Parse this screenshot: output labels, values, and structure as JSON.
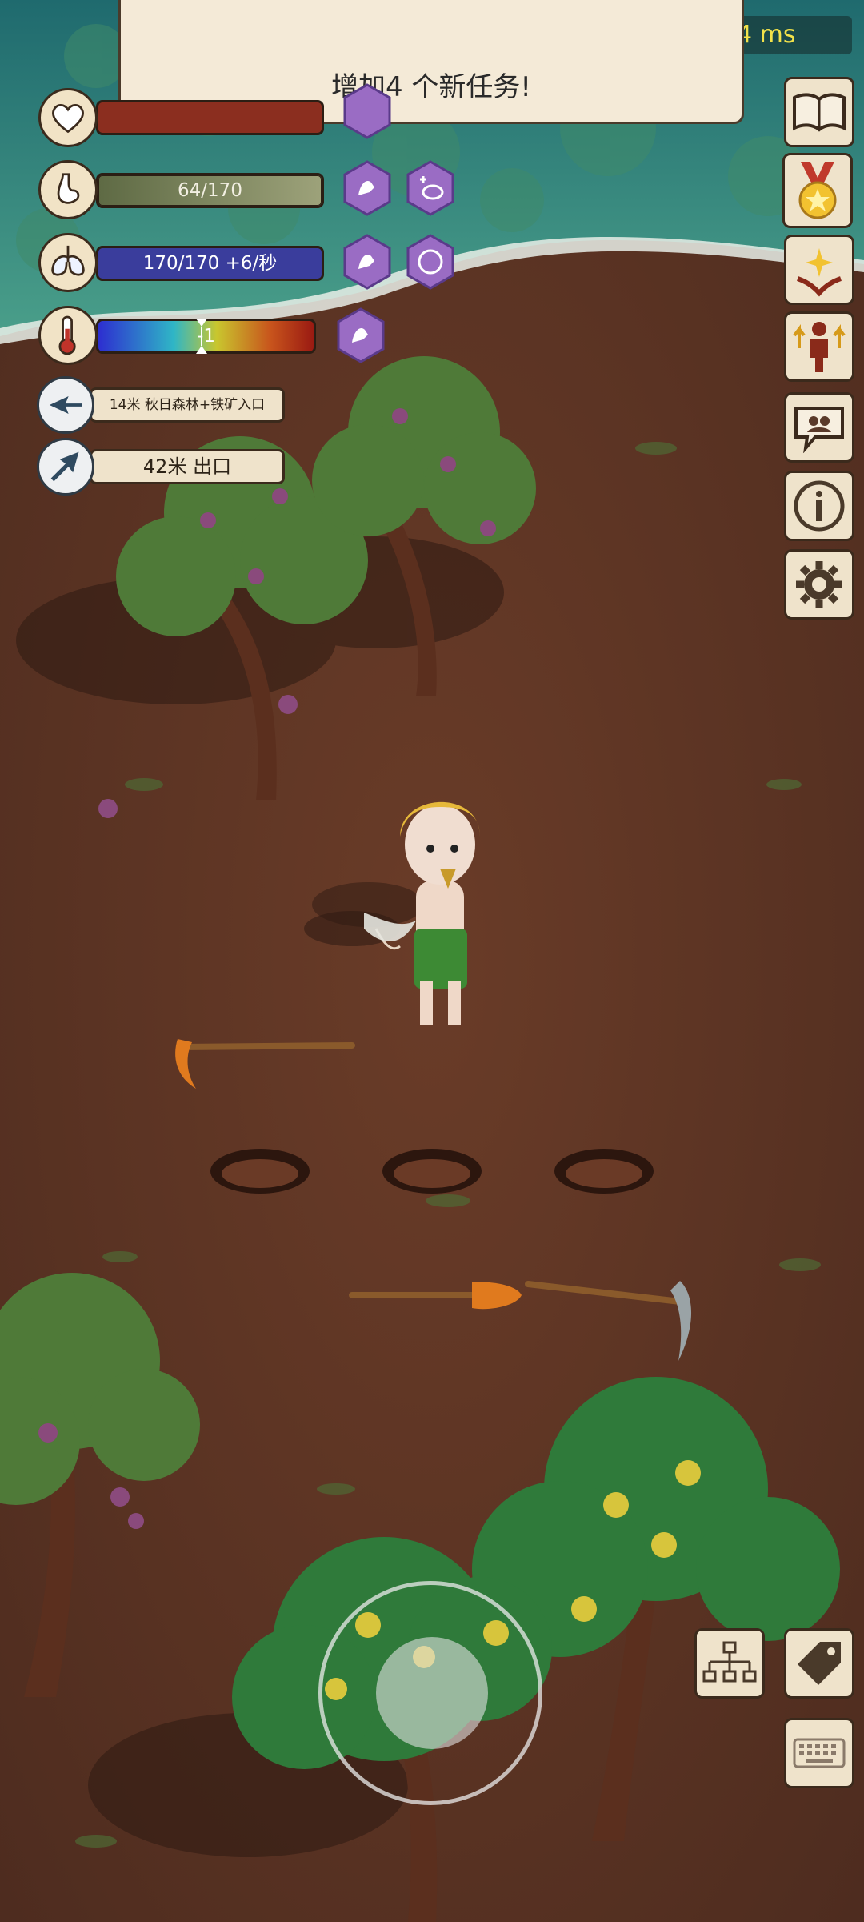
{
  "notification": {
    "text": "增加4 个新任务!"
  },
  "ping": "4 ms",
  "stats": {
    "health": {
      "icon": "heart-icon"
    },
    "hunger": {
      "text": "64/170",
      "fraction": 0.376,
      "icon": "stomach-icon"
    },
    "oxygen": {
      "text": "170/170 +6/秒",
      "fraction": 1.0,
      "icon": "lungs-icon"
    },
    "temperature": {
      "text": "-1",
      "icon": "thermometer-icon"
    }
  },
  "navigation": [
    {
      "text": "14米 秋日森林+铁矿入口",
      "icon": "compass-arrow-left-icon"
    },
    {
      "text": "42米 出口",
      "icon": "compass-arrow-upright-icon"
    }
  ],
  "side_buttons": [
    "book-icon",
    "medal-icon",
    "sparkle-hands-icon",
    "character-upgrade-icon",
    "chat-bubble-icon",
    "info-icon",
    "settings-gear-icon"
  ],
  "bottom_buttons": [
    "hierarchy-icon",
    "tag-icon",
    "keyboard-icon"
  ],
  "colors": {
    "ground": "#5a3424",
    "water": "#2f7f7a",
    "health": "#8b2e1f",
    "hunger": "#8f9670",
    "oxygen": "#3a3d9c",
    "hex_purple": "#9a6cc4"
  }
}
